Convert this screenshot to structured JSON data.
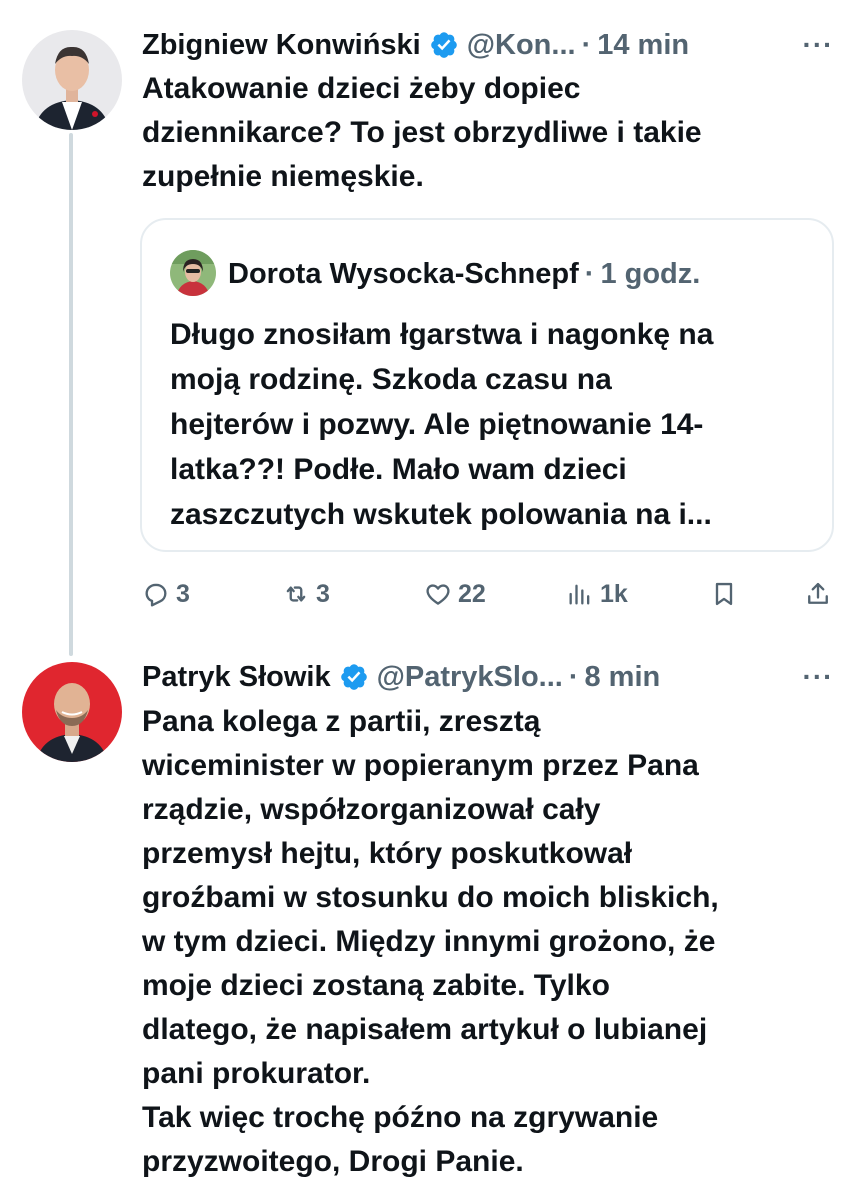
{
  "tweets": [
    {
      "author": "Zbigniew Konwiński",
      "handle": "@Kon...",
      "separator": "·",
      "time": "14 min",
      "more": "···",
      "text": "Atakowanie dzieci żeby dopiec\ndziennikarce? To jest obrzydliwe i takie\nzupełnie niemęskie.",
      "quote": {
        "author": "Dorota Wysocka-Schnepf",
        "separator": "·",
        "time": "1 godz.",
        "text": "Długo znosiłam łgarstwa i nagonkę na\nmoją rodzinę. Szkoda czasu na\nhejterów i pozwy. Ale piętnowanie 14-\nlatka??! Podłe. Mało wam dzieci\nzaszczutych wskutek polowania na i..."
      },
      "actions": {
        "replies": "3",
        "retweets": "3",
        "likes": "22",
        "views": "1k"
      }
    },
    {
      "author": "Patryk Słowik",
      "handle": "@PatrykSlo...",
      "separator": "·",
      "time": "8 min",
      "more": "···",
      "text": "Pana kolega z partii, zresztą\nwiceminister w popieranym przez Pana\nrządzie, współzorganizował cały\nprzemysł hejtu, który poskutkował\ngroźbami w stosunku do moich bliskich,\nw tym dzieci. Między innymi grożono, że\nmoje dzieci zostaną zabite. Tylko\ndlatego, że napisałem artykuł o lubianej\npani prokurator.\nTak więc trochę późno na zgrywanie\nprzyzwoitego, Drogi Panie."
    }
  ],
  "colors": {
    "verified": "#1d9bf0",
    "muted": "#536471",
    "text": "#0f1419",
    "thread_line": "#cfd9de",
    "quote_border": "#e6ecf0"
  },
  "icons": {
    "verified": "verified-badge-icon",
    "reply": "reply-icon",
    "retweet": "retweet-icon",
    "like": "heart-icon",
    "views": "views-bar-chart-icon",
    "bookmark": "bookmark-icon",
    "share": "share-icon",
    "more": "more-dots-icon"
  }
}
